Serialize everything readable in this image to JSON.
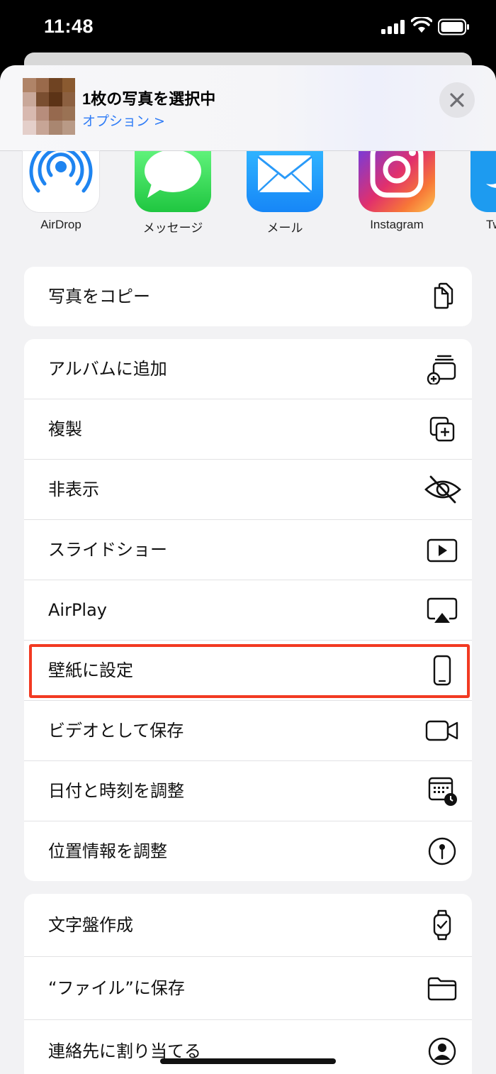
{
  "status_bar": {
    "time": "11:48"
  },
  "share_sheet": {
    "title": "1枚の写真を選択中",
    "options_label": "オプション >",
    "apps": [
      {
        "label": "AirDrop",
        "icon": "airdrop-icon"
      },
      {
        "label": "メッセージ",
        "icon": "messages-icon"
      },
      {
        "label": "メール",
        "icon": "mail-icon"
      },
      {
        "label": "Instagram",
        "icon": "instagram-icon"
      },
      {
        "label": "Tw",
        "icon": "twitter-icon"
      }
    ],
    "groups": [
      {
        "items": [
          {
            "label": "写真をコピー",
            "icon": "copy-icon"
          }
        ]
      },
      {
        "items": [
          {
            "label": "アルバムに追加",
            "icon": "add-album-icon"
          },
          {
            "label": "複製",
            "icon": "duplicate-icon"
          },
          {
            "label": "非表示",
            "icon": "eye-slash-icon"
          },
          {
            "label": "スライドショー",
            "icon": "play-icon"
          },
          {
            "label": "AirPlay",
            "icon": "airplay-icon"
          },
          {
            "label": "壁紙に設定",
            "icon": "iphone-icon",
            "highlighted": true
          },
          {
            "label": "ビデオとして保存",
            "icon": "video-icon"
          },
          {
            "label": "日付と時刻を調整",
            "icon": "calendar-clock-icon"
          },
          {
            "label": "位置情報を調整",
            "icon": "location-pin-icon"
          }
        ]
      },
      {
        "items": [
          {
            "label": "文字盤作成",
            "icon": "watch-icon"
          },
          {
            "label": "“ファイル”に保存",
            "icon": "folder-icon"
          },
          {
            "label": "連絡先に割り当てる",
            "icon": "contact-icon"
          }
        ]
      }
    ]
  },
  "colors": {
    "accent": "#2f7cf6",
    "highlight": "#f23a22",
    "sheet_bg": "#f2f2f4"
  }
}
